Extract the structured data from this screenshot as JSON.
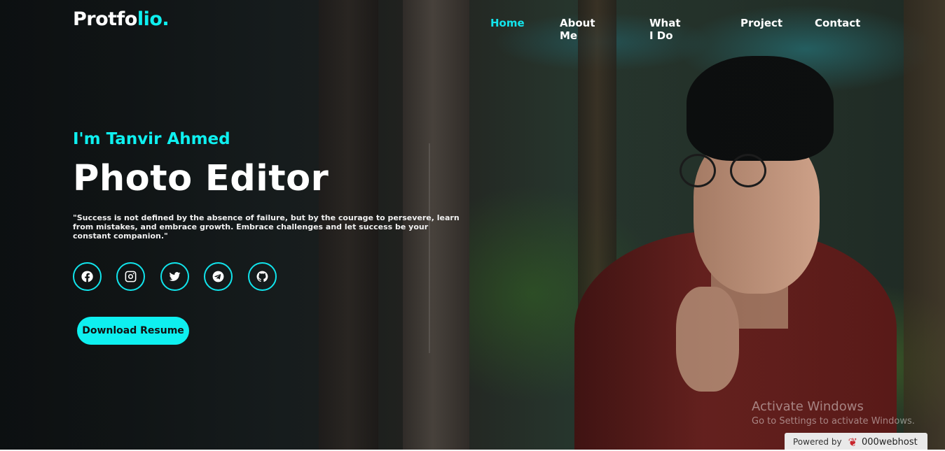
{
  "navbar": {
    "logo_part1": "Protfo",
    "logo_part2": "lio.",
    "links": [
      "Home",
      "About Me",
      "What I Do",
      "Project",
      "Contact"
    ],
    "active": "Home"
  },
  "hero": {
    "intro": "I'm Tanvir Ahmed",
    "headline": "Photo Editor",
    "quote": "\"Success is not defined by the absence of failure, but by the courage to persevere, learn from mistakes, and embrace growth. Embrace challenges and let success be your constant companion.\"",
    "socials": [
      "facebook-icon",
      "instagram-icon",
      "twitter-icon",
      "telegram-icon",
      "github-icon"
    ],
    "resume_button": "Download Resume"
  },
  "overlay": {
    "activate_title": "Activate Windows",
    "activate_sub": "Go to Settings to activate Windows.",
    "powered_by": "Powered by",
    "host_brand": "000webhost"
  },
  "colors": {
    "accent": "#0ef0f0"
  }
}
